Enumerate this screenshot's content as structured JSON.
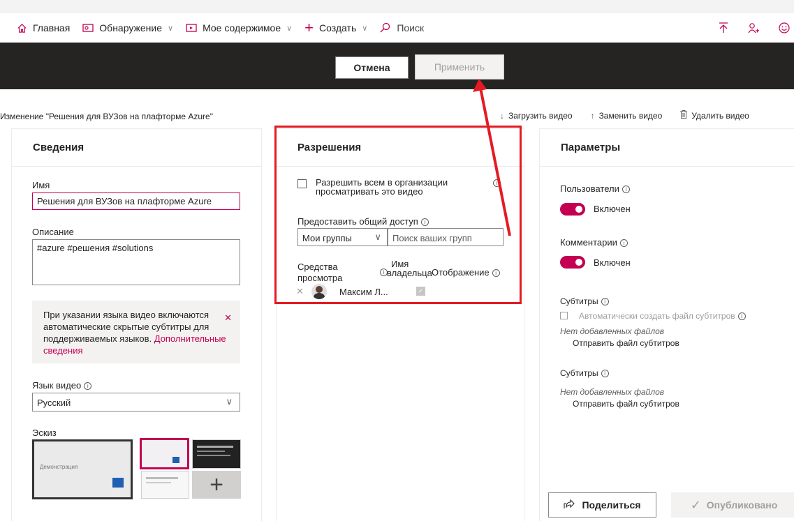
{
  "nav": {
    "home": "Главная",
    "discover": "Обнаружение",
    "my_content": "Мое содержимое",
    "create": "Создать",
    "search": "Поиск"
  },
  "actions": {
    "cancel": "Отмена",
    "apply": "Применить"
  },
  "edit_title": "Изменение \"Решения для ВУЗов на плафторме Azure\"",
  "toolbar": {
    "upload": "Загрузить видео",
    "replace": "Заменить видео",
    "delete": "Удалить видео"
  },
  "details": {
    "heading": "Сведения",
    "name_label": "Имя",
    "name_value": "Решения для ВУЗов на плафторме Azure",
    "desc_label": "Описание",
    "desc_value": "#azure #решения #solutions",
    "notice_text": "При указании языка видео включаются автоматические скрытые субтитры для поддерживаемых языков.",
    "notice_link": "Дополнительные сведения",
    "lang_label": "Язык видео",
    "lang_value": "Русский",
    "thumb_label": "Эскиз",
    "thumb_main_text": "Демонстрация"
  },
  "permissions": {
    "heading": "Разрешения",
    "allow_all": "Разрешить всем в организации просматривать это видео",
    "share_label": "Предоставить общий доступ",
    "group_value": "Мои группы",
    "group_search_placeholder": "Поиск ваших групп",
    "col_viewers": "Средства просмотра",
    "col_owner": "Имя владельца",
    "col_display": "Отображение",
    "row_name": "Максим Л..."
  },
  "params": {
    "heading": "Параметры",
    "users_label": "Пользователи",
    "users_state": "Включен",
    "comments_label": "Комментарии",
    "comments_state": "Включен",
    "subs1_label": "Субтитры",
    "auto_subs": "Автоматически создать файл субтитров",
    "no_files_1": "Нет добавленных файлов",
    "send_subs_1": "Отправить файл субтитров",
    "subs2_label": "Субтитры",
    "no_files_2": "Нет добавленных файлов",
    "send_subs_2": "Отправить файл субтитров"
  },
  "footer": {
    "share": "Поделиться",
    "published": "Опубликовано"
  },
  "colors": {
    "accent": "#c30052",
    "dark_bar": "#252423",
    "annotation": "#e31b23"
  }
}
